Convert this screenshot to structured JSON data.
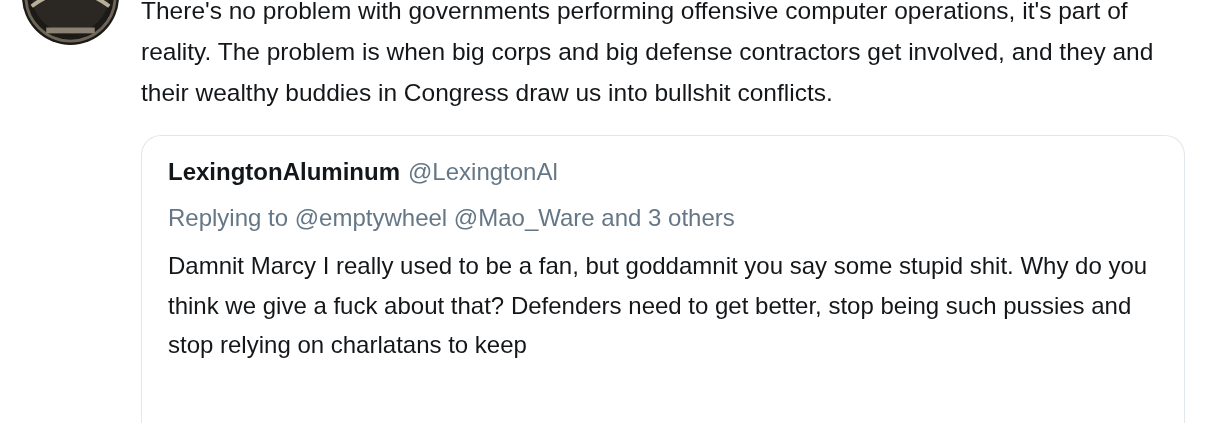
{
  "tweet": {
    "text": "There's no problem with governments performing offensive computer operations, it's part of reality. The problem is when big corps and big defense contractors get involved, and they and their wealthy buddies in Congress draw us into bullshit conflicts.",
    "quoted_tweet": {
      "display_name": "LexingtonAluminum",
      "handle": "@LexingtonAl",
      "replying_to": "Replying to @emptywheel @Mao_Ware and 3 others",
      "text": "Damnit Marcy I really used to be a fan, but goddamnit you say some stupid shit. Why do you think we give a fuck about that? Defenders need to get better, stop being such pussies and stop relying on charlatans to keep"
    }
  }
}
